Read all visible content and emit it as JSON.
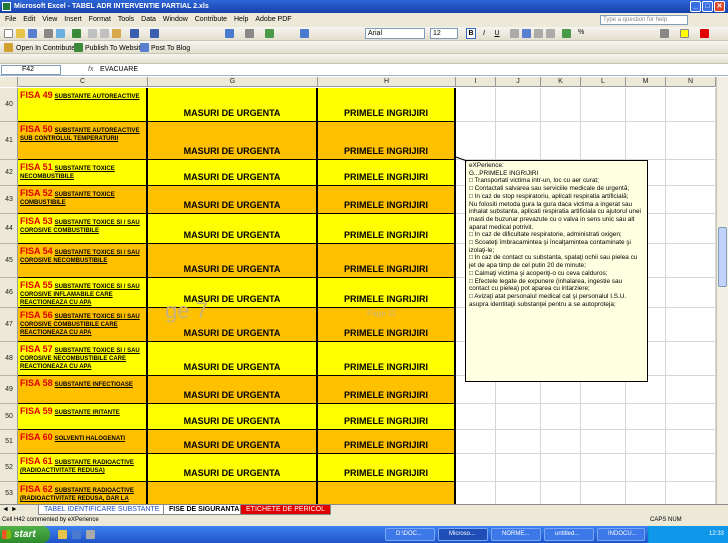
{
  "window": {
    "title": "Microsoft Excel - TABEL ADR INTERVENTIE PARTIAL 2.xls",
    "min": "_",
    "max": "□",
    "close": "✕"
  },
  "menu": [
    "File",
    "Edit",
    "View",
    "Insert",
    "Format",
    "Tools",
    "Data",
    "Window",
    "Contribute",
    "Help",
    "Adobe PDF"
  ],
  "help_placeholder": "Type a question for help",
  "toolbar2": {
    "open_contribute": "Open In Contribute",
    "publish": "Publish To Website",
    "post_blog": "Post To Blog"
  },
  "font": {
    "name": "Arial",
    "size": "12",
    "bold": "B",
    "italic": "I",
    "underline": "U",
    "percent": "%"
  },
  "formula": {
    "cell": "F42",
    "fx": "fx",
    "value": "EVACUARE"
  },
  "columns": [
    "C",
    "G",
    "H",
    "I",
    "J",
    "K",
    "L",
    "M",
    "N"
  ],
  "rows": [
    {
      "num": "40",
      "fisa": "FISA 49",
      "desc": "SUBSTANTE AUTOREACTIVE",
      "g": "MASURI DE  URGENTA",
      "h": "PRIMELE INGRIJIRI",
      "color": "#ffff00"
    },
    {
      "num": "41",
      "fisa": "FISA 50",
      "desc": "SUBSTANTE AUTOREACTIVE SUB CONTROLUL TEMPERATURII",
      "g": "MASURI DE  URGENTA",
      "h": "PRIMELE INGRIJIRI",
      "color": "#ffc000"
    },
    {
      "num": "42",
      "fisa": "FISA 51",
      "desc": "SUBSTANTE TOXICE NECOMBUSTIBILE",
      "g": "MASURI DE  URGENTA",
      "h": "PRIMELE INGRIJIRI",
      "color": "#ffff00"
    },
    {
      "num": "43",
      "fisa": "FISA 52",
      "desc": "SUBSTANTE  TOXICE COMBUSTIBILE",
      "g": "MASURI DE  URGENTA",
      "h": "PRIMELE INGRIJIRI",
      "color": "#ffc000"
    },
    {
      "num": "44",
      "fisa": "FISA 53",
      "desc": "SUBSTANTE  TOXICE  SI / SAU COROSIVE COMBUSTIBILE",
      "g": "MASURI DE  URGENTA",
      "h": "PRIMELE INGRIJIRI",
      "color": "#ffff00"
    },
    {
      "num": "45",
      "fisa": "FISA 54",
      "desc": "SUBSTANTE  TOXICE  SI / SAU COROSIVE NECOMBUSTIBILE",
      "g": "MASURI DE  URGENTA",
      "h": "PRIMELE INGRIJIRI",
      "color": "#ffc000"
    },
    {
      "num": "46",
      "fisa": "FISA 55",
      "desc": "SUBSTANTE TOXICE SI / SAU COROSIVE INFLAMABILE  CARE REACTIONEAZA CU APA",
      "g": "MASURI DE  URGENTA",
      "h": "PRIMELE INGRIJIRI",
      "color": "#ffff00"
    },
    {
      "num": "47",
      "fisa": "FISA 56",
      "desc": "SUBSTANTE TOXICE SI / SAU COROSIVE  COMBUSTIBILE  CARE REACTIONEAZA CU APA",
      "g": "MASURI DE  URGENTA",
      "h": "PRIMELE INGRIJIRI",
      "color": "#ffc000"
    },
    {
      "num": "48",
      "fisa": "FISA 57",
      "desc": "SUBSTANTE TOXICE SI / SAU COROSIVE NECOMBUSTIBILE  CARE REACTIONEAZA CU APA",
      "g": "MASURI DE  URGENTA",
      "h": "PRIMELE INGRIJIRI",
      "color": "#ffff00"
    },
    {
      "num": "49",
      "fisa": "FISA 58",
      "desc": "SUBSTANTE INFECTIOASE",
      "g": "MASURI DE  URGENTA",
      "h": "PRIMELE INGRIJIRI",
      "color": "#ffc000"
    },
    {
      "num": "50",
      "fisa": "FISA 59",
      "desc": "SUBSTANTE IRITANTE",
      "g": "MASURI DE  URGENTA",
      "h": "PRIMELE INGRIJIRI",
      "color": "#ffff00"
    },
    {
      "num": "51",
      "fisa": "FISA 60",
      "desc": "SOLVENTI HALOGENATI",
      "g": "MASURI DE  URGENTA",
      "h": "PRIMELE INGRIJIRI",
      "color": "#ffc000"
    },
    {
      "num": "52",
      "fisa": "FISA 61",
      "desc": "SUBSTANTE RADIOACTIVE (RADIOACTIVITATE REDUSA)",
      "g": "MASURI DE  URGENTA",
      "h": "PRIMELE INGRIJIRI",
      "color": "#ffff00"
    },
    {
      "num": "53",
      "fisa": "FISA 62",
      "desc": "SUBSTANTE RADIOACTIVE (RADIOACTIVITATE REDUSA, DAR LA ",
      "g": "",
      "h": "",
      "color": "#ffc000"
    }
  ],
  "comment": {
    "author": "eXPerience:",
    "title": "G...PRIMELE INGRIJIRI",
    "lines": [
      "□ Transportati victima intr-un, loc cu aer curat;",
      "□ Contactati salvarea sau serviciile medicale de urgentă;",
      "□ In caz de stop respiratoriu, aplicati respiratia artificială;",
      "Nu folositi metoda gura la gura daca victima a ingerat sau inhalat substanta, aplicati respiratia artificiala cu ajutorul unei masti de buzunar prevazute cu o valva in sens unic sau alt aparat medical potrivit.",
      "□ In caz de dificultate respiratorie, administrati oxigen;",
      "□ Scoateţi îmbracamintea şi încalţamintea contaminate şi izolaţi-le;",
      "□ In caz de contact cu substanta, spalaţi ochii sau pielea cu jet de apa timp de cel putin 20 de minute;",
      "□ Calmaţi victima şi acoperiţi-o cu ceva calduros;",
      "□ Efectele legate de expunere (inhalarea, ingestie sau contact cu pielea) pot aparea cu  intarziere;",
      "□ Avizaţi atat personalul medical cat şi personalul I.S.U. asupra identitaţii substanţei pentru a se autoproteja;"
    ]
  },
  "watermark": "ge 7",
  "watermark2": "Page 11",
  "sheet_tabs": [
    "TABEL IDENTIFICARE SUBSTANTE",
    "FISE DE SIGURANTA",
    "ETICHETE DE PERICOL"
  ],
  "status": {
    "left": "Cell H42 commented by eXPerience",
    "right": "CAPS  NUM"
  },
  "taskbar": {
    "start": "start",
    "tasks": [
      "D:\\DOC...",
      "Microso...",
      "NORME...",
      "untitled...",
      "INDOCU..."
    ],
    "clock": "12:33"
  }
}
